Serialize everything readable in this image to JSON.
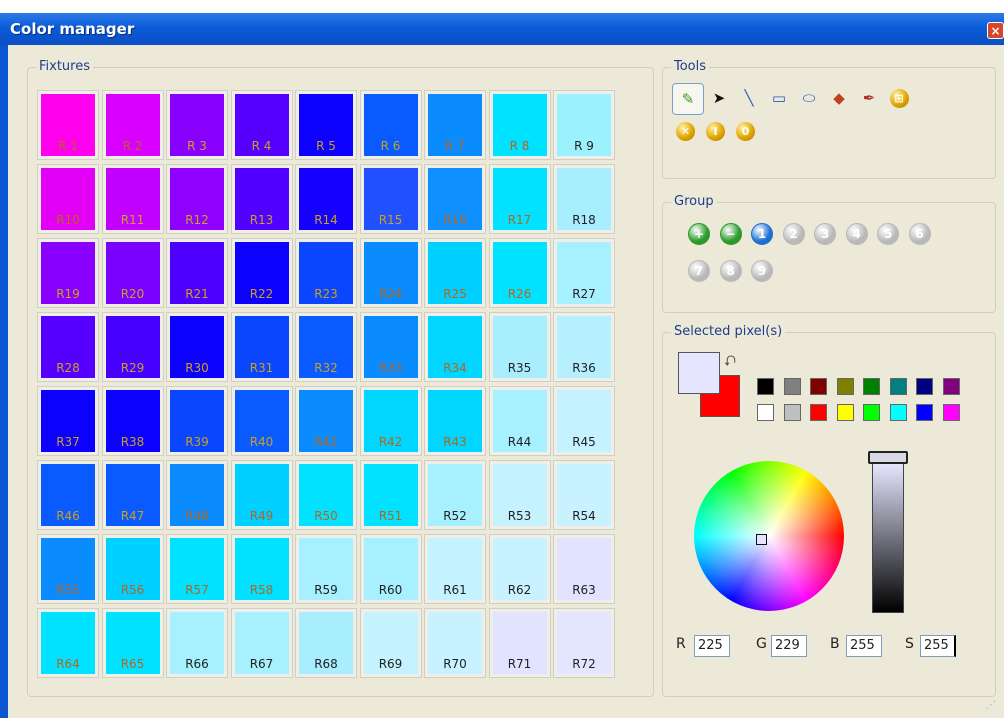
{
  "window": {
    "title": "Color manager",
    "close_symbol": "×"
  },
  "fixtures": {
    "legend": "Fixtures",
    "cells": [
      {
        "label": "R 1",
        "color": "#ff00ee"
      },
      {
        "label": "R 2",
        "color": "#d900ff"
      },
      {
        "label": "R 3",
        "color": "#8a00ff"
      },
      {
        "label": "R 4",
        "color": "#5500ff"
      },
      {
        "label": "R 5",
        "color": "#0c00ff"
      },
      {
        "label": "R 6",
        "color": "#0a5bff"
      },
      {
        "label": "R 7",
        "color": "#0a8cff"
      },
      {
        "label": "R 8",
        "color": "#00e2ff"
      },
      {
        "label": "R 9",
        "color": "#9cf1ff"
      },
      {
        "label": "R10",
        "color": "#e200f6"
      },
      {
        "label": "R11",
        "color": "#c200ff"
      },
      {
        "label": "R12",
        "color": "#9000ff"
      },
      {
        "label": "R13",
        "color": "#5200ff"
      },
      {
        "label": "R14",
        "color": "#1600ff"
      },
      {
        "label": "R15",
        "color": "#2050ff"
      },
      {
        "label": "R16",
        "color": "#1090ff"
      },
      {
        "label": "R17",
        "color": "#00e2ff"
      },
      {
        "label": "R18",
        "color": "#a8eeff"
      },
      {
        "label": "R19",
        "color": "#8a00ff"
      },
      {
        "label": "R20",
        "color": "#7a00ff"
      },
      {
        "label": "R21",
        "color": "#4c00ff"
      },
      {
        "label": "R22",
        "color": "#0c00ff"
      },
      {
        "label": "R23",
        "color": "#0b46ff"
      },
      {
        "label": "R24",
        "color": "#0a8cff"
      },
      {
        "label": "R25",
        "color": "#00d0ff"
      },
      {
        "label": "R26",
        "color": "#00e2ff"
      },
      {
        "label": "R27",
        "color": "#a6f0ff"
      },
      {
        "label": "R28",
        "color": "#5500ff"
      },
      {
        "label": "R29",
        "color": "#4500ff"
      },
      {
        "label": "R30",
        "color": "#0c00ff"
      },
      {
        "label": "R31",
        "color": "#0b46ff"
      },
      {
        "label": "R32",
        "color": "#0a5bff"
      },
      {
        "label": "R33",
        "color": "#0a8cff"
      },
      {
        "label": "R34",
        "color": "#00d6ff"
      },
      {
        "label": "R35",
        "color": "#a8eeff"
      },
      {
        "label": "R36",
        "color": "#b6f0ff"
      },
      {
        "label": "R37",
        "color": "#0c00ff"
      },
      {
        "label": "R38",
        "color": "#0c00ff"
      },
      {
        "label": "R39",
        "color": "#0b46ff"
      },
      {
        "label": "R40",
        "color": "#0a5bff"
      },
      {
        "label": "R41",
        "color": "#0a8cff"
      },
      {
        "label": "R42",
        "color": "#00d6ff"
      },
      {
        "label": "R43",
        "color": "#00d6ff"
      },
      {
        "label": "R44",
        "color": "#a6f0ff"
      },
      {
        "label": "R45",
        "color": "#c4f2ff"
      },
      {
        "label": "R46",
        "color": "#0a5bff"
      },
      {
        "label": "R47",
        "color": "#0a5bff"
      },
      {
        "label": "R48",
        "color": "#0a8cff"
      },
      {
        "label": "R49",
        "color": "#00d0ff"
      },
      {
        "label": "R50",
        "color": "#00e2ff"
      },
      {
        "label": "R51",
        "color": "#00e2ff"
      },
      {
        "label": "R52",
        "color": "#a6f0ff"
      },
      {
        "label": "R53",
        "color": "#c4f2ff"
      },
      {
        "label": "R54",
        "color": "#c8f2ff"
      },
      {
        "label": "R55",
        "color": "#0a8cff"
      },
      {
        "label": "R56",
        "color": "#00d0ff"
      },
      {
        "label": "R57",
        "color": "#00e2ff"
      },
      {
        "label": "R58",
        "color": "#00e2ff"
      },
      {
        "label": "R59",
        "color": "#a6f0ff"
      },
      {
        "label": "R60",
        "color": "#a6f0ff"
      },
      {
        "label": "R61",
        "color": "#c4f2ff"
      },
      {
        "label": "R62",
        "color": "#c8f2ff"
      },
      {
        "label": "R63",
        "color": "#e2e4ff"
      },
      {
        "label": "R64",
        "color": "#00e2ff"
      },
      {
        "label": "R65",
        "color": "#00e2ff"
      },
      {
        "label": "R66",
        "color": "#a6f0ff"
      },
      {
        "label": "R67",
        "color": "#a6f0ff"
      },
      {
        "label": "R68",
        "color": "#a8eeff"
      },
      {
        "label": "R69",
        "color": "#c4f2ff"
      },
      {
        "label": "R70",
        "color": "#c8f2ff"
      },
      {
        "label": "R71",
        "color": "#e2e4ff"
      },
      {
        "label": "R72",
        "color": "#e4e6ff"
      }
    ]
  },
  "tools": {
    "legend": "Tools",
    "buttons": [
      {
        "icon": "pencil-icon",
        "glyph": "✎",
        "color": "#3c9a2c"
      },
      {
        "icon": "select-arrow-icon",
        "glyph": "➤",
        "color": "#111"
      },
      {
        "icon": "line-icon",
        "glyph": "╲",
        "color": "#2b5db5"
      },
      {
        "icon": "rectangle-icon",
        "glyph": "▭",
        "color": "#2b5db5"
      },
      {
        "icon": "ellipse-icon",
        "glyph": "⬭",
        "color": "#2b5db5"
      },
      {
        "icon": "fill-bucket-icon",
        "glyph": "◆",
        "color": "#c04020"
      },
      {
        "icon": "eyedropper-icon",
        "glyph": "✒",
        "color": "#b03030"
      },
      {
        "icon": "grid-icon",
        "glyph": "⊞",
        "color": "#fff"
      }
    ],
    "row2": [
      {
        "icon": "clear-icon",
        "glyph": "✕"
      },
      {
        "icon": "info-icon",
        "glyph": "I"
      },
      {
        "icon": "zero-icon",
        "glyph": "0"
      }
    ]
  },
  "group": {
    "legend": "Group",
    "buttons": [
      {
        "icon": "add-group-icon",
        "glyph": "+",
        "color": "#2a9a2a"
      },
      {
        "icon": "remove-group-icon",
        "glyph": "−",
        "color": "#2a9a2a"
      },
      {
        "icon": "group-1-icon",
        "glyph": "1",
        "color": "#1a6fd0"
      },
      {
        "icon": "group-2-icon",
        "glyph": "2",
        "color": "#b8b8b8"
      },
      {
        "icon": "group-3-icon",
        "glyph": "3",
        "color": "#b8b8b8"
      },
      {
        "icon": "group-4-icon",
        "glyph": "4",
        "color": "#b8b8b8"
      },
      {
        "icon": "group-5-icon",
        "glyph": "5",
        "color": "#b8b8b8"
      },
      {
        "icon": "group-6-icon",
        "glyph": "6",
        "color": "#b8b8b8"
      },
      {
        "icon": "group-7-icon",
        "glyph": "7",
        "color": "#b8b8b8"
      },
      {
        "icon": "group-8-icon",
        "glyph": "8",
        "color": "#b8b8b8"
      },
      {
        "icon": "group-9-icon",
        "glyph": "9",
        "color": "#b8b8b8"
      }
    ]
  },
  "selected": {
    "legend": "Selected pixel(s)",
    "foreground": "#e5e5ff",
    "background": "#ff0000",
    "palette": [
      "#000000",
      "#808080",
      "#800000",
      "#808000",
      "#008000",
      "#008080",
      "#000080",
      "#800080",
      "#ffffff",
      "#c0c0c0",
      "#ff0000",
      "#ffff00",
      "#00ff00",
      "#00ffff",
      "#0000ff",
      "#ff00ff"
    ],
    "r_label": "R",
    "r_value": "225",
    "g_label": "G",
    "g_value": "229",
    "b_label": "B",
    "b_value": "255",
    "s_label": "S",
    "s_value": "255"
  }
}
